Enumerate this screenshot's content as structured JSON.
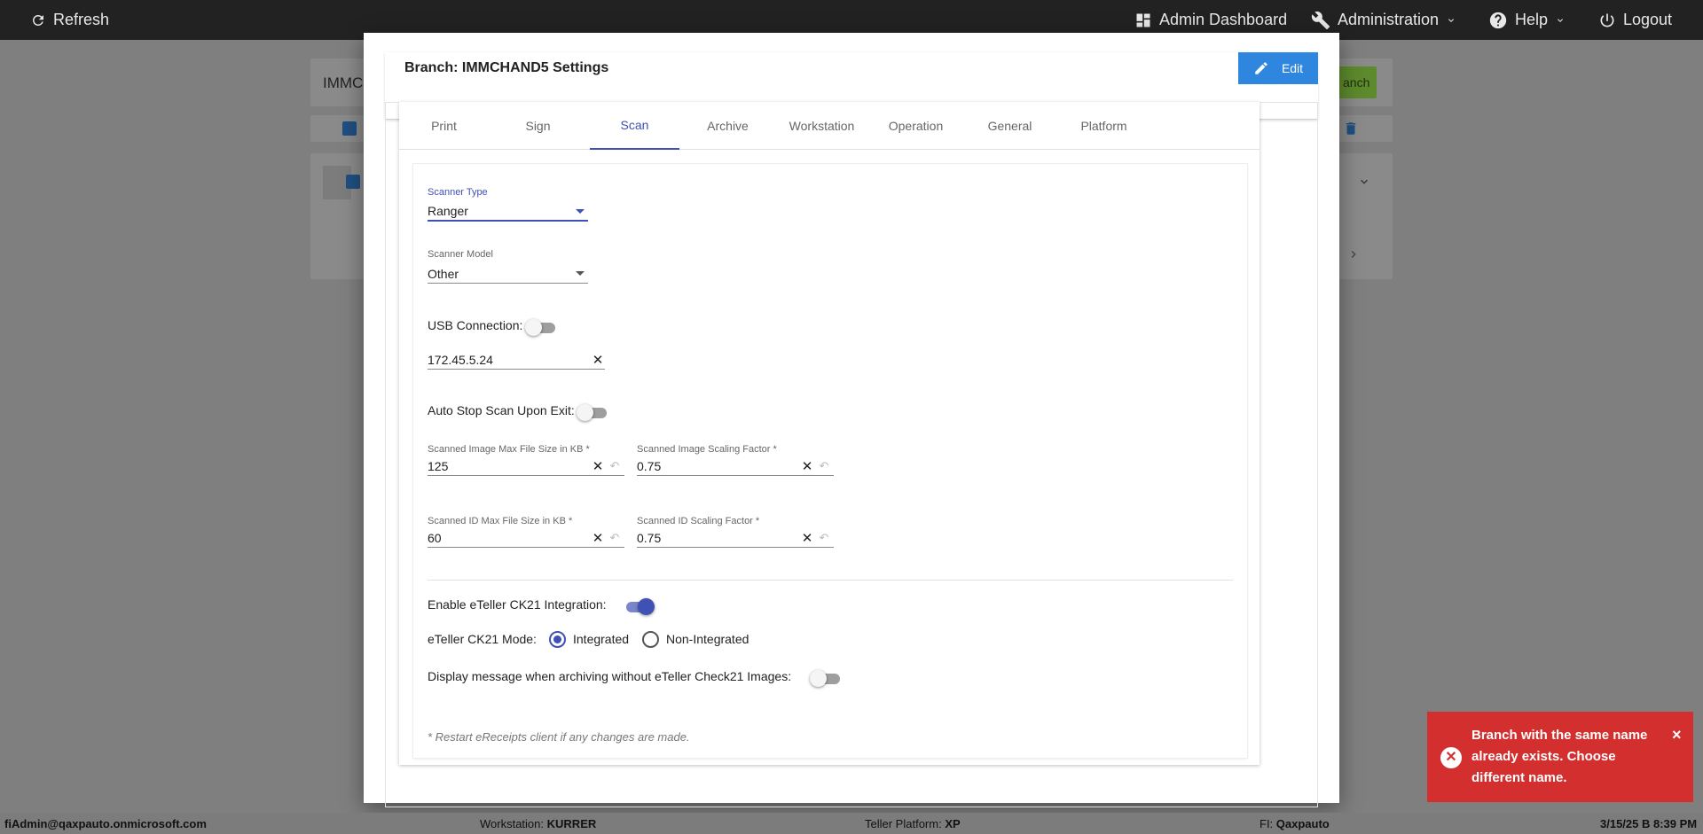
{
  "topbar": {
    "refresh": "Refresh",
    "admin_dashboard": "Admin Dashboard",
    "administration": "Administration",
    "help": "Help",
    "logout": "Logout"
  },
  "background": {
    "search_value": "IMMCI",
    "add_branch_partial": "anch"
  },
  "modal": {
    "title": "Branch: IMMCHAND5 Settings",
    "edit_label": "Edit",
    "tabs": [
      "Print",
      "Sign",
      "Scan",
      "Archive",
      "Workstation",
      "Operation",
      "General",
      "Platform"
    ],
    "active_tab": "Scan",
    "scan": {
      "scanner_type_label": "Scanner Type",
      "scanner_type_value": "Ranger",
      "scanner_model_label": "Scanner Model",
      "scanner_model_value": "Other",
      "usb_connection_label": "USB Connection:",
      "usb_connection_on": false,
      "ip_value": "172.45.5.24",
      "auto_stop_label": "Auto Stop Scan Upon Exit:",
      "auto_stop_on": false,
      "image_max_size_label": "Scanned Image Max File Size in KB *",
      "image_max_size_value": "125",
      "image_scaling_label": "Scanned Image Scaling Factor *",
      "image_scaling_value": "0.75",
      "id_max_size_label": "Scanned ID Max File Size in KB *",
      "id_max_size_value": "60",
      "id_scaling_label": "Scanned ID Scaling Factor *",
      "id_scaling_value": "0.75",
      "eteller_enable_label": "Enable eTeller CK21 Integration:",
      "eteller_enable_on": true,
      "eteller_mode_label": "eTeller CK21 Mode:",
      "mode_integrated": "Integrated",
      "mode_non_integrated": "Non-Integrated",
      "selected_mode": "Integrated",
      "display_message_label": "Display message when archiving without eTeller Check21 Images:",
      "display_message_on": false,
      "restart_note": "* Restart eReceipts client if any changes are made."
    }
  },
  "toast": {
    "message": "Branch with the same name already exists. Choose different name."
  },
  "footer": {
    "user": "fiAdmin@qaxpauto.onmicrosoft.com",
    "workstation_label": "Workstation:",
    "workstation_value": "KURRER",
    "platform_label": "Teller Platform:",
    "platform_value": "XP",
    "fi_label": "FI:",
    "fi_value": "Qaxpauto",
    "datetime": "3/15/25 B 8:39 PM"
  },
  "colors": {
    "accent": "#3f51b5",
    "edit_button": "#2e86de",
    "toast_bg": "#d32f2f",
    "topbar_bg": "#222222"
  }
}
